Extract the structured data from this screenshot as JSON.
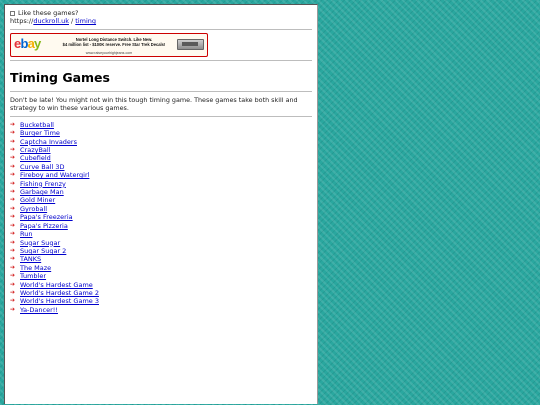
{
  "like": {
    "label": "Like these games?"
  },
  "breadcrumb": {
    "prefix": "https://",
    "site": "duckroll.uk",
    "separator": " / ",
    "section": "timing"
  },
  "ad": {
    "logo_letters": [
      "e",
      "b",
      "a",
      "y"
    ],
    "line1": "Nortel Long Distance Switch. Like New.",
    "line2": "$4 million list - $100K reserve. Free Star Trek Decals!",
    "footer": "www.raiseyourhighjeans.com"
  },
  "title": "Timing Games",
  "intro": "Don't be late! You might not win this tough timing game. These games take both skill and strategy to win these various games.",
  "games": [
    "Bucketball",
    "Burger Time",
    "Captcha Invaders",
    "CrazyBall",
    "Cubefield",
    "Curve Ball 3D",
    "Fireboy and Watergirl",
    "Fishing Frenzy",
    "Garbage Man",
    "Gold Miner",
    "Gyroball",
    "Papa's Freezeria",
    "Papa's Pizzeria",
    "Run",
    "Sugar Sugar",
    "Sugar Sugar 2",
    "TANKS",
    "The Maze",
    "Tumbler",
    "World's Hardest Game",
    "World's Hardest Game 2",
    "World's Hardest Game 3",
    "Ya-Dancer!!"
  ],
  "colors": {
    "background": "#2aa79f",
    "link": "#0000cc",
    "bullet": "#d11a1a"
  },
  "icons": {
    "bullet": "arrow-right-icon"
  }
}
